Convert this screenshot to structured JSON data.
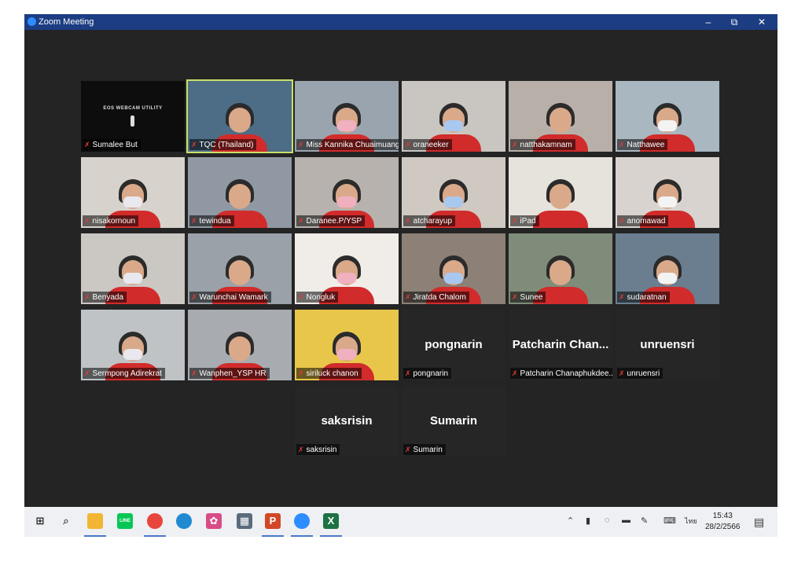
{
  "window": {
    "title": "Zoom Meeting",
    "controls": {
      "minimize": "–",
      "restore": "⧉",
      "close": "✕"
    }
  },
  "participants": [
    {
      "name": "Sumalee But",
      "kind": "webcam-utility",
      "overlay": "EOS WEBCAM UTILITY"
    },
    {
      "name": "TQC (Thailand)",
      "kind": "video",
      "speaker": true
    },
    {
      "name": "Miss Kannika Chuaimuang",
      "kind": "video"
    },
    {
      "name": "oraneeker",
      "kind": "video"
    },
    {
      "name": "natthakamnam",
      "kind": "video"
    },
    {
      "name": "Natthawee",
      "kind": "video"
    },
    {
      "name": "nisakornoun",
      "kind": "video"
    },
    {
      "name": "tewindua",
      "kind": "video"
    },
    {
      "name": "Daranee.P/YSP",
      "kind": "video"
    },
    {
      "name": "atcharayup",
      "kind": "video"
    },
    {
      "name": "iPad",
      "kind": "video"
    },
    {
      "name": "anomawad",
      "kind": "video"
    },
    {
      "name": "Benyada",
      "kind": "video"
    },
    {
      "name": "Warunchai Wamark",
      "kind": "video"
    },
    {
      "name": "Nongluk",
      "kind": "video"
    },
    {
      "name": "Jiratda Chalom",
      "kind": "video"
    },
    {
      "name": "Sunee",
      "kind": "video"
    },
    {
      "name": "sudaratnan",
      "kind": "video"
    },
    {
      "name": "Sermpong Adirekrat",
      "kind": "video"
    },
    {
      "name": "Wanphen_YSP HR",
      "kind": "video"
    },
    {
      "name": "siriluck chanon",
      "kind": "video"
    },
    {
      "name": "pongnarin",
      "kind": "name-only",
      "display": "pongnarin"
    },
    {
      "name": "Patcharin Chanaphukdee...",
      "kind": "name-only",
      "display": "Patcharin Chan..."
    },
    {
      "name": "unruensri",
      "kind": "name-only",
      "display": "unruensri"
    },
    {
      "name": "saksrisin",
      "kind": "name-only",
      "display": "saksrisin"
    },
    {
      "name": "Sumarin",
      "kind": "name-only",
      "display": "Sumarin"
    }
  ],
  "taskbar": {
    "apps": [
      {
        "name": "windows-start",
        "label": "⊞",
        "color": "#1e1e1e"
      },
      {
        "name": "search",
        "label": "⌕",
        "color": "#555555"
      },
      {
        "name": "file-explorer",
        "label": "",
        "color": "#f2b634"
      },
      {
        "name": "line",
        "label": "LINE",
        "color": "#06c755"
      },
      {
        "name": "chrome",
        "label": "",
        "color": "#e8453c"
      },
      {
        "name": "edge",
        "label": "",
        "color": "#1f8ad2"
      },
      {
        "name": "pinwheel",
        "label": "✿",
        "color": "#d94b86"
      },
      {
        "name": "calculator",
        "label": "▦",
        "color": "#5a6b7c"
      },
      {
        "name": "powerpoint",
        "label": "P",
        "color": "#d24726"
      },
      {
        "name": "zoom",
        "label": "",
        "color": "#2d8cff"
      },
      {
        "name": "excel",
        "label": "X",
        "color": "#1e7145"
      }
    ],
    "tray": {
      "language": "ไทย",
      "time": "15:43",
      "date": "28/2/2566"
    }
  }
}
